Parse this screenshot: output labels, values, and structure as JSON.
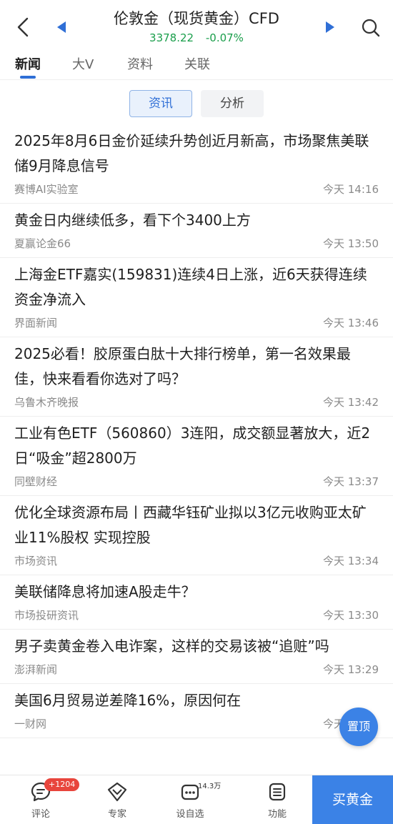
{
  "header": {
    "title": "伦敦金（现货黄金）CFD",
    "price": "3378.22",
    "change": "-0.07%"
  },
  "tabs": [
    {
      "label": "新闻",
      "active": true
    },
    {
      "label": "大V",
      "active": false
    },
    {
      "label": "资料",
      "active": false
    },
    {
      "label": "关联",
      "active": false
    }
  ],
  "subtabs": [
    {
      "label": "资讯",
      "active": true
    },
    {
      "label": "分析",
      "active": false
    }
  ],
  "news": [
    {
      "title": "2025年8月6日金价延续升势创近月新高，市场聚焦美联储9月降息信号",
      "source": "赛博AI实验室",
      "time": "今天 14:16"
    },
    {
      "title": "黄金日内继续低多，看下个3400上方",
      "source": "夏赢论金66",
      "time": "今天 13:50"
    },
    {
      "title": "上海金ETF嘉实(159831)连续4日上涨，近6天获得连续资金净流入",
      "source": "界面新闻",
      "time": "今天 13:46"
    },
    {
      "title": "2025必看！胶原蛋白肽十大排行榜单，第一名效果最佳，快来看看你选对了吗？",
      "source": "乌鲁木齐晚报",
      "time": "今天 13:42"
    },
    {
      "title": "工业有色ETF（560860）3连阳，成交额显著放大，近2日“吸金”超2800万",
      "source": "同壁财经",
      "time": "今天 13:37"
    },
    {
      "title": "优化全球资源布局丨西藏华钰矿业拟以3亿元收购亚太矿业11%股权 实现控股",
      "source": "市场资讯",
      "time": "今天 13:34"
    },
    {
      "title": "美联储降息将加速A股走牛？",
      "source": "市场投研资讯",
      "time": "今天 13:30"
    },
    {
      "title": "男子卖黄金卷入电诈案，这样的交易该被“追赃”吗",
      "source": "澎湃新闻",
      "time": "今天 13:29"
    },
    {
      "title": "美国6月贸易逆差降16%，原因何在",
      "source": "一财网",
      "time": "今天 13:21"
    }
  ],
  "to_top_label": "置顶",
  "bottom_bar": {
    "comment": {
      "label": "评论",
      "badge": "+1204",
      "icon": "comment-icon"
    },
    "expert": {
      "label": "专家",
      "icon": "expert-icon"
    },
    "watchlist": {
      "label": "设自选",
      "count": "14.3万",
      "icon": "watchlist-icon"
    },
    "functions": {
      "label": "功能",
      "icon": "menu-icon"
    },
    "buy_label": "买黄金"
  },
  "colors": {
    "accent": "#3b82e6",
    "price_green": "#1a9e4b",
    "badge_red": "#e8453c"
  }
}
